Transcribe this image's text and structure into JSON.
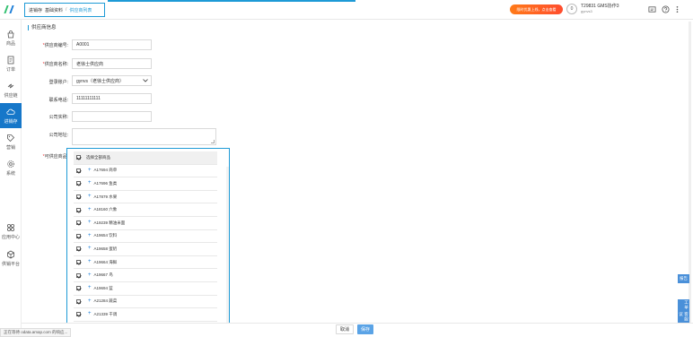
{
  "topbar": {
    "breadcrumb": [
      "进销存",
      "基础资料",
      "供应商列表"
    ],
    "breadcrumb_sep": "/",
    "promo_label": "限时优惠上线，点击查看",
    "avatar_letter": "0",
    "user_name": "T29831 GMS协作3",
    "user_sub": "gynvs3"
  },
  "sidebar": {
    "items": [
      {
        "label": "商品",
        "icon": "bag-icon"
      },
      {
        "label": "订单",
        "icon": "document-icon"
      },
      {
        "label": "供应链",
        "icon": "chain-icon"
      },
      {
        "label": "进销存",
        "icon": "cloud-icon",
        "active": true
      },
      {
        "label": "营销",
        "icon": "tag-icon"
      },
      {
        "label": "系统",
        "icon": "gear-icon"
      },
      {
        "label": "应用中心",
        "icon": "apps-icon"
      },
      {
        "label": "供销平台",
        "icon": "cube-icon"
      }
    ]
  },
  "form": {
    "section_title": "供应商信息",
    "fields": [
      {
        "label": "供应商编号:",
        "value": "A0001",
        "required": true
      },
      {
        "label": "供应商名称:",
        "value": "老徐士供应商",
        "required": true
      },
      {
        "label": "登录账户:",
        "value": "gynvs（老徐士供应商）",
        "required": false
      },
      {
        "label": "联系电话:",
        "value": "11111111111",
        "required": false
      },
      {
        "label": "公司实称:",
        "value": "",
        "required": false
      },
      {
        "label": "公司地址:",
        "value": "",
        "required": false
      },
      {
        "label": "可供应商品:",
        "value": "",
        "required": true
      }
    ]
  },
  "goods": {
    "select_all_label": "选择全部商品",
    "items": [
      "A17694 商单",
      "A17696 鱼类",
      "A17879 水果",
      "A18160 六象",
      "A19239 精油米面",
      "A19654 饮料",
      "A19658 蛋奶",
      "A19664 海鲜",
      "A19667 鸟",
      "A19694 蓝",
      "A21284 蔬菜",
      "A21339 干调"
    ]
  },
  "footer": {
    "status_text": "正在等待 odata.amap.com 的响应...",
    "cancel_label": "取消",
    "save_label": "保存"
  },
  "right_tabs": {
    "top_label": "报告",
    "bottom_label": "工单 客服 建议"
  },
  "colors": {
    "primary": "#1e9ad6",
    "sidebar_active": "#1677c9",
    "promo": "#ff6a24",
    "save_button": "#5aa3e6"
  }
}
